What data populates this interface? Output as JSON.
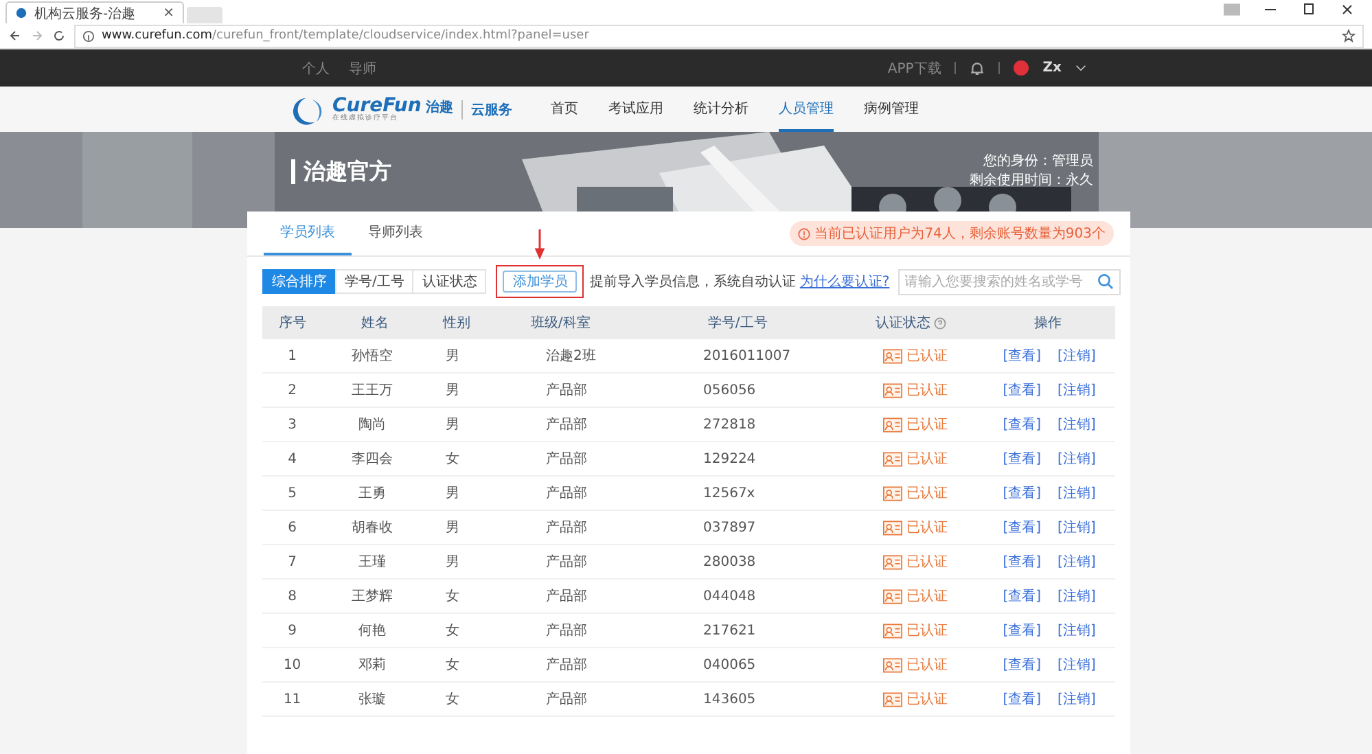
{
  "browser": {
    "tab_title": "机构云服务-治趣",
    "tab_close": "×",
    "url": "**www.curefun.com**/curefun_front/template/cloudservice/index.html?panel=user"
  },
  "topbar": {
    "links": [
      "个人",
      "导师"
    ],
    "app_download": "APP下载",
    "user": "Zx"
  },
  "nav": {
    "logo": "CureFun",
    "logo_cn": "治趣",
    "logo_sub": "在线虚拟诊疗平台",
    "service": "云服务",
    "items": [
      {
        "label": "首页",
        "selected": false
      },
      {
        "label": "考试应用",
        "selected": false
      },
      {
        "label": "统计分析",
        "selected": false
      },
      {
        "label": "人员管理",
        "selected": true
      },
      {
        "label": "病例管理",
        "selected": false
      }
    ]
  },
  "banner": {
    "org": "治趣官方",
    "role": "您的身份：管理员",
    "remaining": "剩余使用时间：永久"
  },
  "tabs": [
    {
      "label": "学员列表",
      "selected": true
    },
    {
      "label": "导师列表",
      "selected": false
    }
  ],
  "notice": "当前已认证用户为74人，剩余账号数量为903个",
  "filters": [
    {
      "label": "综合排序",
      "selected": true
    },
    {
      "label": "学号/工号",
      "selected": false
    },
    {
      "label": "认证状态",
      "selected": false
    }
  ],
  "add_button": "添加学员",
  "hint": "提前导入学员信息，系统自动认证",
  "hint_link": "为什么要认证?",
  "search": {
    "placeholder": "请输入您要搜索的姓名或学号"
  },
  "table": {
    "columns": [
      "序号",
      "姓名",
      "性别",
      "班级/科室",
      "学号/工号",
      "认证状态",
      "操作"
    ],
    "rows": [
      {
        "no": "1",
        "name": "孙悟空",
        "gender": "男",
        "dept": "治趣2班",
        "id": "2016011007",
        "status": "已认证",
        "actions": [
          "[查看]",
          "[注销]"
        ]
      },
      {
        "no": "2",
        "name": "王王万",
        "gender": "男",
        "dept": "产品部",
        "id": "056056",
        "status": "已认证",
        "actions": [
          "[查看]",
          "[注销]"
        ]
      },
      {
        "no": "3",
        "name": "陶尚",
        "gender": "男",
        "dept": "产品部",
        "id": "272818",
        "status": "已认证",
        "actions": [
          "[查看]",
          "[注销]"
        ]
      },
      {
        "no": "4",
        "name": "李四会",
        "gender": "女",
        "dept": "产品部",
        "id": "129224",
        "status": "已认证",
        "actions": [
          "[查看]",
          "[注销]"
        ]
      },
      {
        "no": "5",
        "name": "王勇",
        "gender": "男",
        "dept": "产品部",
        "id": "12567x",
        "status": "已认证",
        "actions": [
          "[查看]",
          "[注销]"
        ]
      },
      {
        "no": "6",
        "name": "胡春收",
        "gender": "男",
        "dept": "产品部",
        "id": "037897",
        "status": "已认证",
        "actions": [
          "[查看]",
          "[注销]"
        ]
      },
      {
        "no": "7",
        "name": "王瑾",
        "gender": "男",
        "dept": "产品部",
        "id": "280038",
        "status": "已认证",
        "actions": [
          "[查看]",
          "[注销]"
        ]
      },
      {
        "no": "8",
        "name": "王梦辉",
        "gender": "女",
        "dept": "产品部",
        "id": "044048",
        "status": "已认证",
        "actions": [
          "[查看]",
          "[注销]"
        ]
      },
      {
        "no": "9",
        "name": "何艳",
        "gender": "女",
        "dept": "产品部",
        "id": "217621",
        "status": "已认证",
        "actions": [
          "[查看]",
          "[注销]"
        ]
      },
      {
        "no": "10",
        "name": "邓莉",
        "gender": "女",
        "dept": "产品部",
        "id": "040065",
        "status": "已认证",
        "actions": [
          "[查看]",
          "[注销]"
        ]
      },
      {
        "no": "11",
        "name": "张璇",
        "gender": "女",
        "dept": "产品部",
        "id": "143605",
        "status": "已认证",
        "actions": [
          "[查看]",
          "[注销]"
        ]
      }
    ]
  }
}
